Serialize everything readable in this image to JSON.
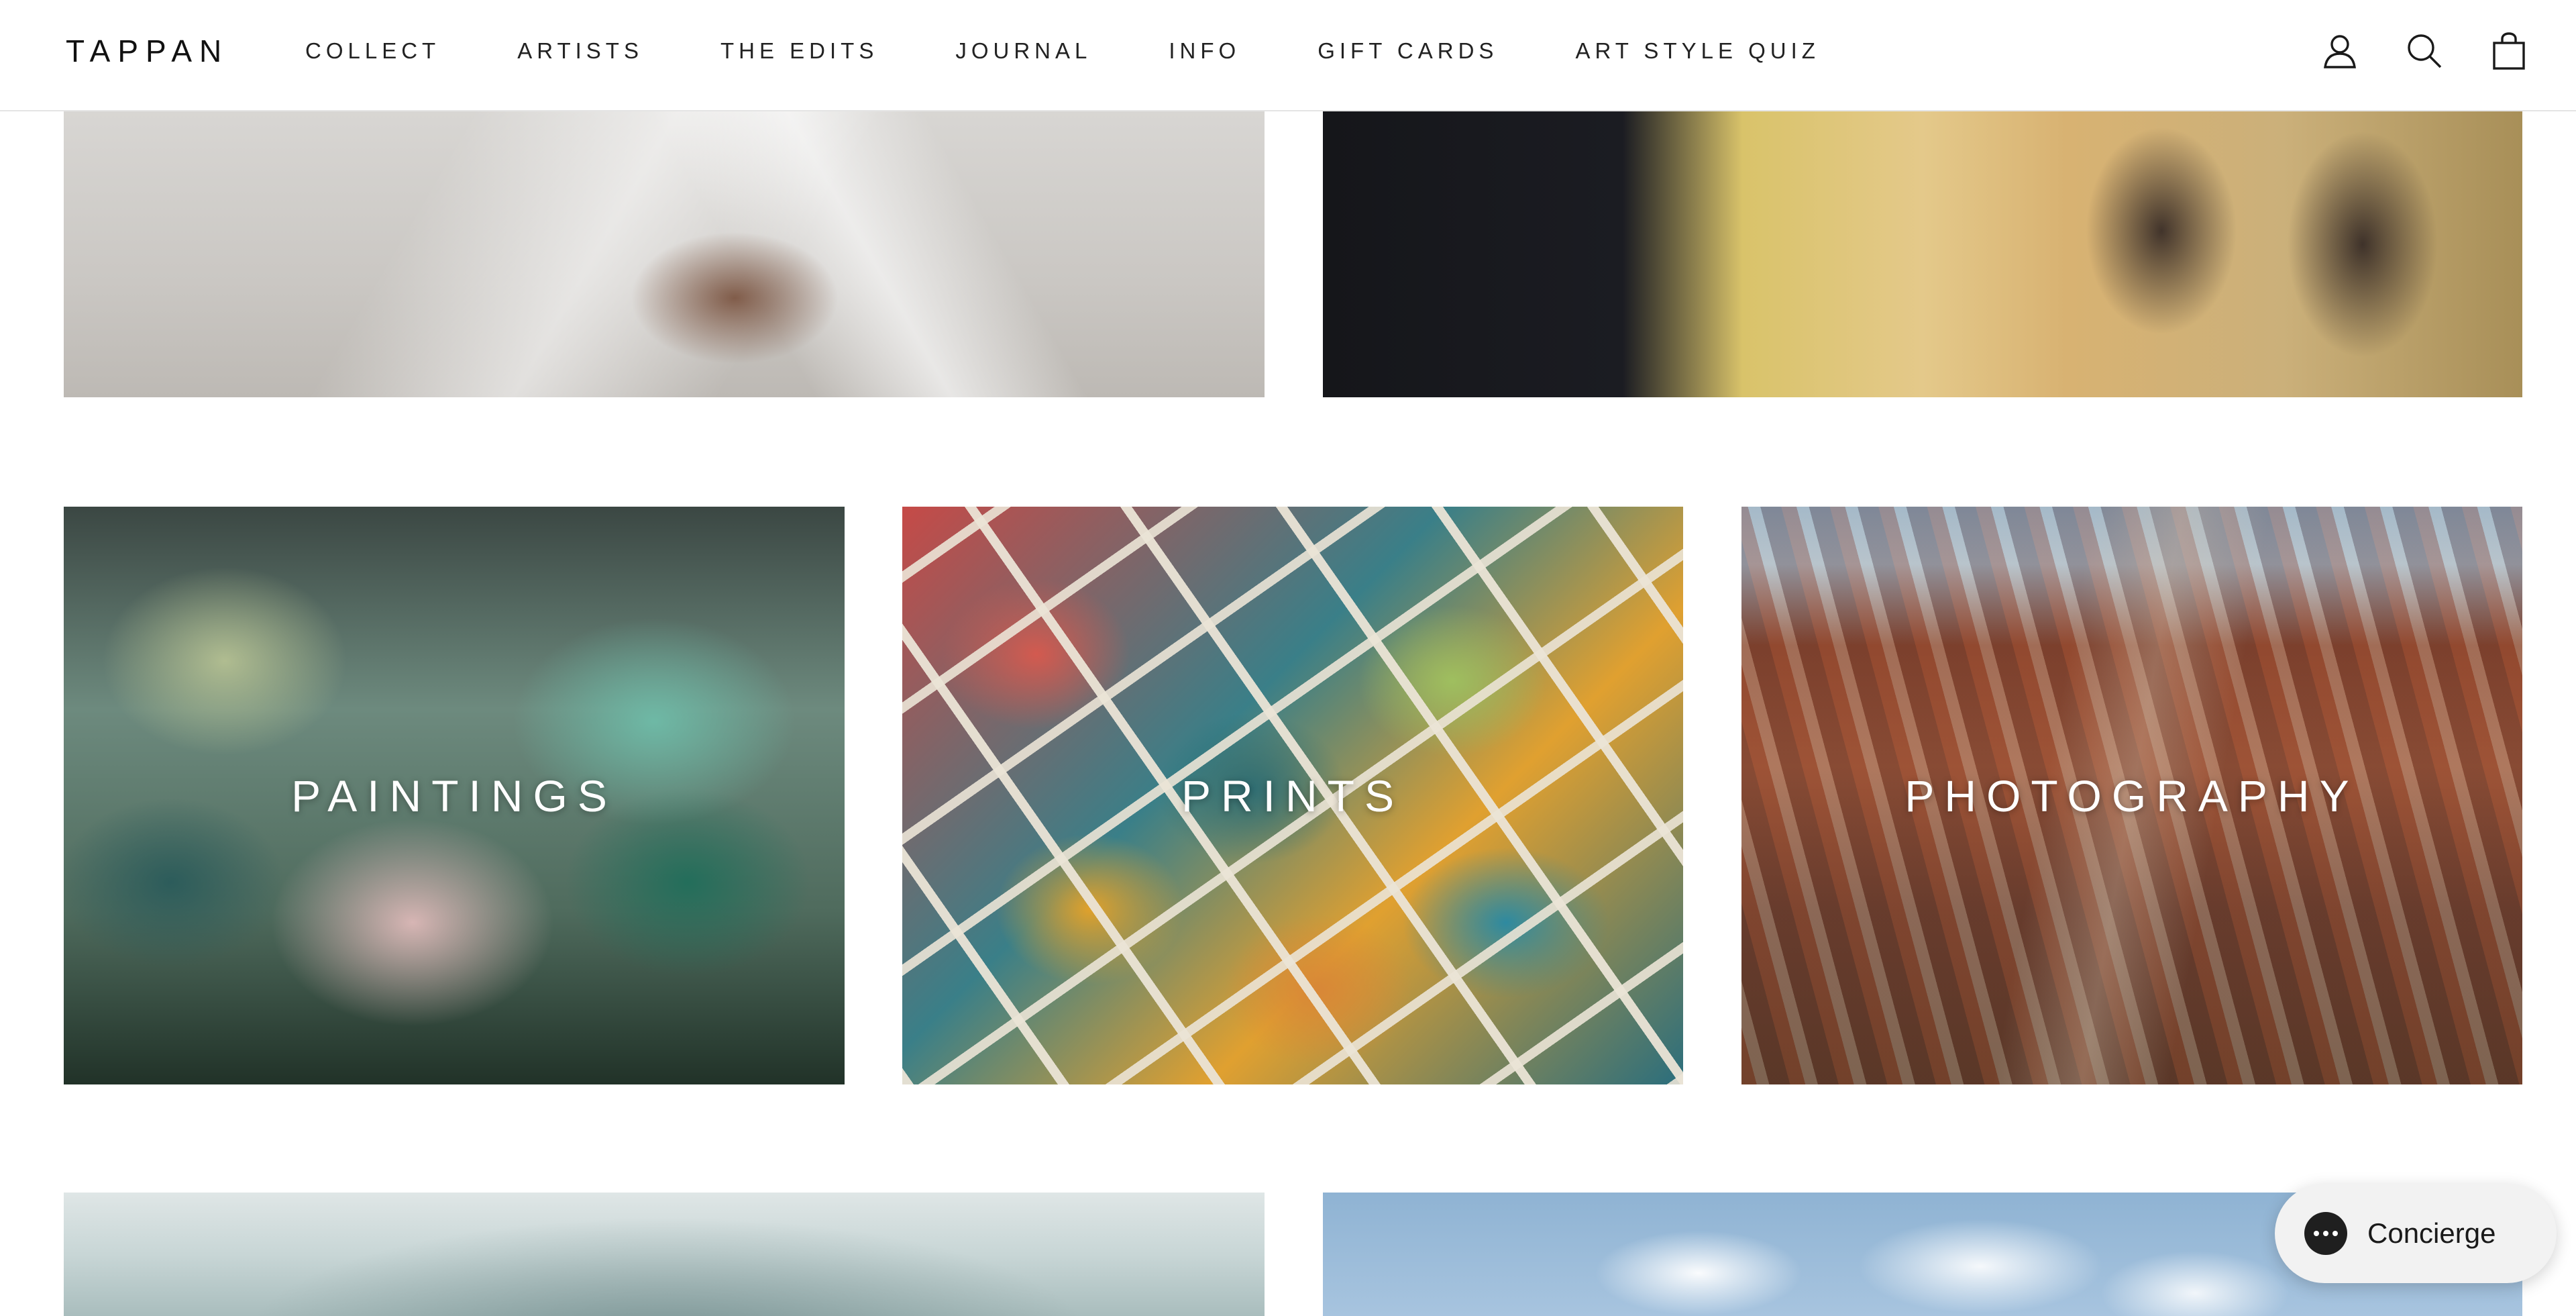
{
  "header": {
    "logo": "TAPPAN",
    "nav": [
      {
        "label": "COLLECT"
      },
      {
        "label": "ARTISTS"
      },
      {
        "label": "THE EDITS"
      },
      {
        "label": "JOURNAL"
      },
      {
        "label": "INFO"
      },
      {
        "label": "GIFT CARDS"
      },
      {
        "label": "ART STYLE QUIZ"
      }
    ],
    "icons": [
      "account-icon",
      "search-icon",
      "cart-icon"
    ]
  },
  "categories": [
    {
      "label": "PAINTINGS"
    },
    {
      "label": "PRINTS"
    },
    {
      "label": "PHOTOGRAPHY"
    }
  ],
  "concierge": {
    "label": "Concierge",
    "icon": "chat-icon"
  }
}
